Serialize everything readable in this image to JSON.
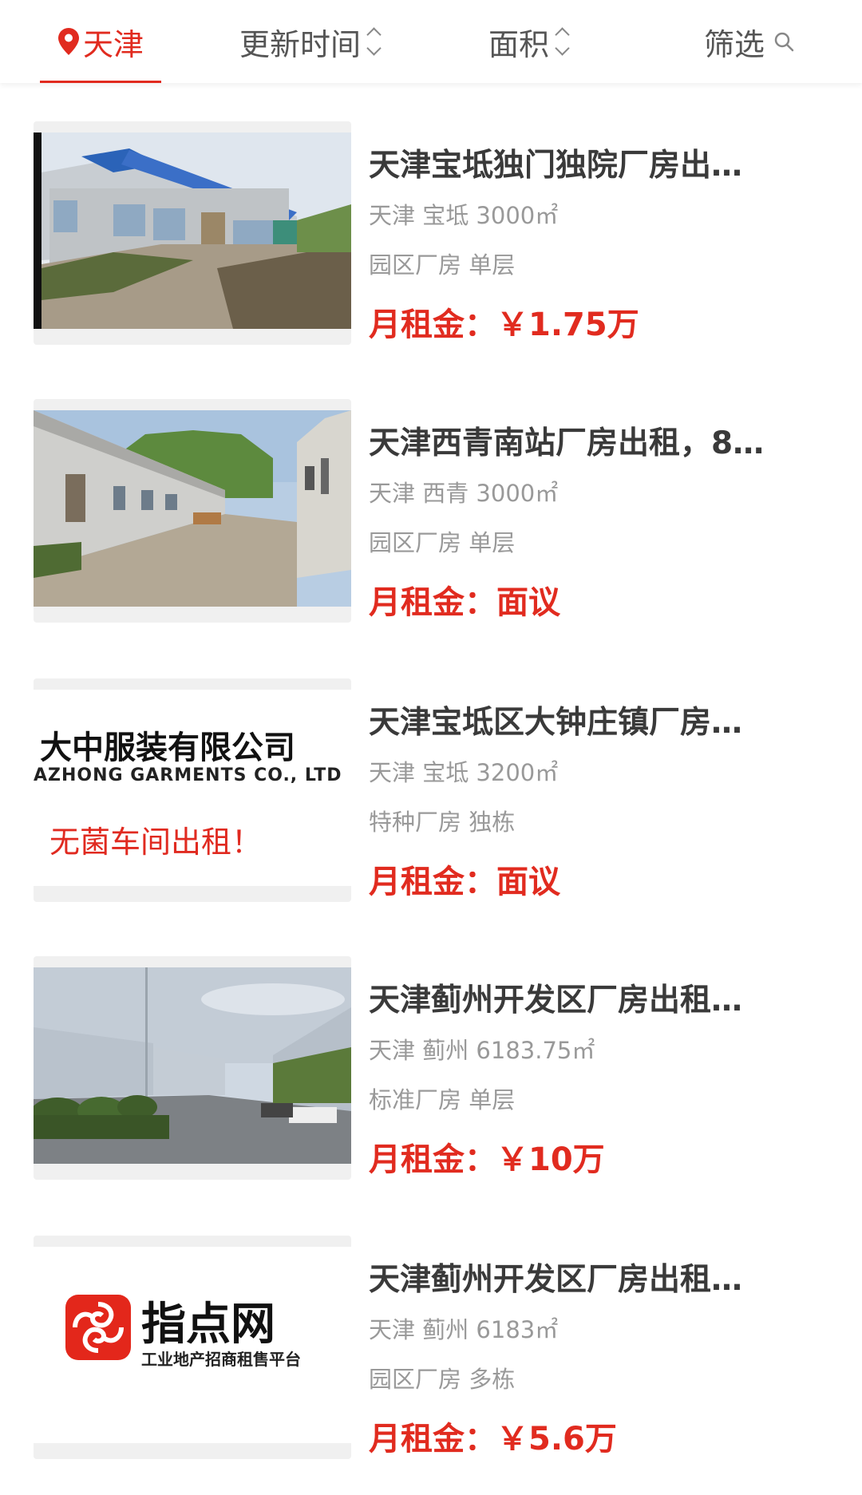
{
  "filters": {
    "city": "天津",
    "sort_update": "更新时间",
    "sort_area": "面积",
    "filter": "筛选",
    "accent_color": "#e12b1f"
  },
  "listings": [
    {
      "title": "天津宝坻独门独院厂房出…",
      "location": "天津 宝坻 3000㎡",
      "type": "园区厂房 单层",
      "price_label": "月租金：",
      "price_value": "￥1.75万"
    },
    {
      "title": "天津西青南站厂房出租，8…",
      "location": "天津 西青 3000㎡",
      "type": "园区厂房 单层",
      "price_label": "月租金：",
      "price_value": "面议"
    },
    {
      "title": "天津宝坻区大钟庄镇厂房…",
      "location": "天津 宝坻 3200㎡",
      "type": "特种厂房 独栋",
      "price_label": "月租金：",
      "price_value": "面议",
      "image_text": {
        "cn": "大中服装有限公司",
        "en": "AZHONG GARMENTS CO., LTD",
        "red": "无菌车间出租！"
      }
    },
    {
      "title": "天津蓟州开发区厂房出租…",
      "location": "天津 蓟州 6183.75㎡",
      "type": "标准厂房 单层",
      "price_label": "月租金：",
      "price_value": "￥10万"
    },
    {
      "title": "天津蓟州开发区厂房出租…",
      "location": "天津 蓟州 6183㎡",
      "type": "园区厂房 多栋",
      "price_label": "月租金：",
      "price_value": "￥5.6万",
      "image_text": {
        "logo": "指点网",
        "slogan": "工业地产招商租售平台"
      }
    }
  ]
}
